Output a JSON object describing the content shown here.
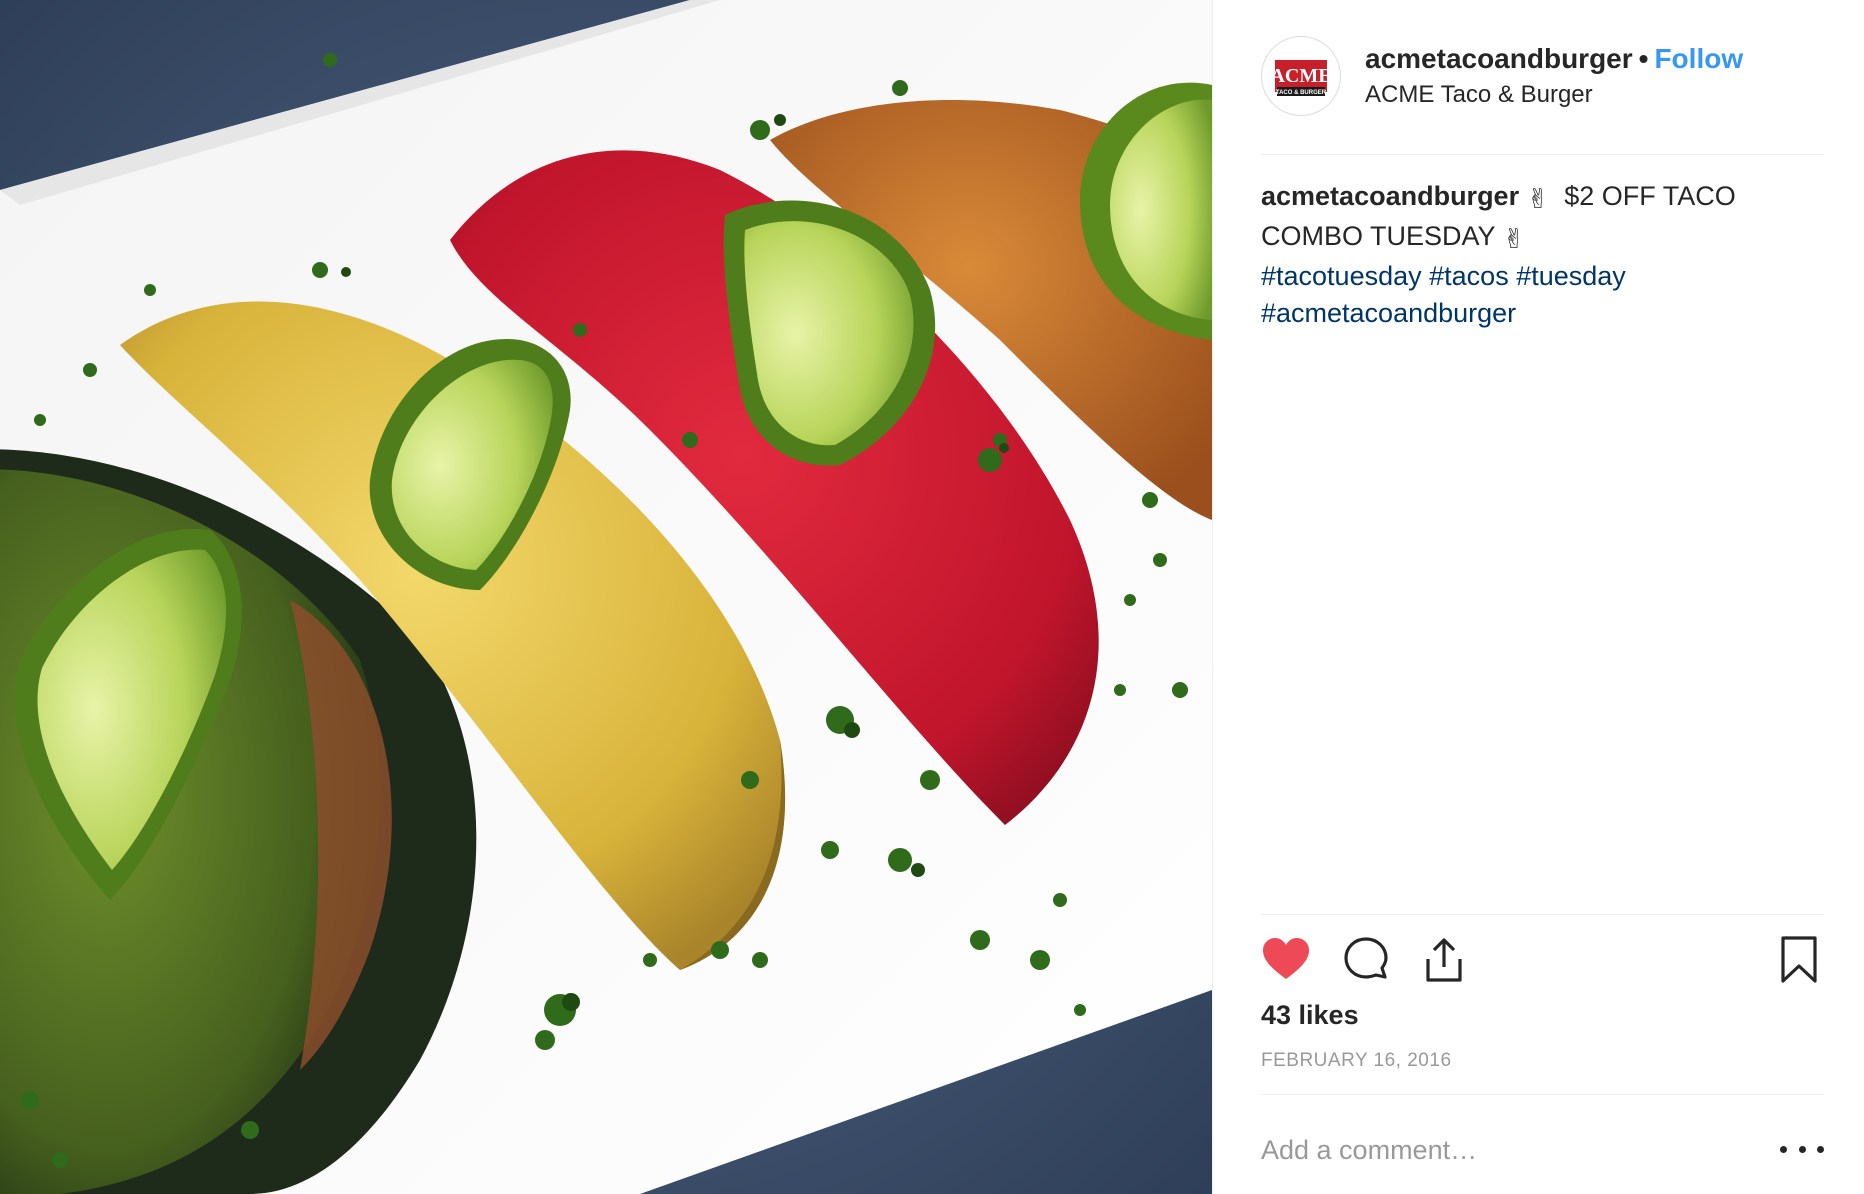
{
  "post": {
    "image": {
      "alt_icon": "taco-photo",
      "description_colors": {
        "plate": "#ffffff",
        "background": "#3b4f6b"
      }
    },
    "header": {
      "avatar_icon": "acme-logo",
      "logo_text_main": "ACME",
      "logo_text_sub": "TACO & BURGER",
      "username": "acmetacoandburger",
      "separator": "•",
      "follow_label": "Follow",
      "location": "ACME Taco & Burger"
    },
    "caption": {
      "username": "acmetacoandburger",
      "emoji_1": "✌",
      "text_line": "$2 OFF TACO COMBO TUESDAY",
      "emoji_2": "✌",
      "hashtags": [
        "#tacotuesday",
        "#tacos",
        "#tuesday",
        "#acmetacoandburger"
      ]
    },
    "actions": {
      "like_icon": "heart-filled-icon",
      "comment_icon": "comment-icon",
      "share_icon": "share-icon",
      "save_icon": "bookmark-icon"
    },
    "likes_text": "43 likes",
    "date": "FEBRUARY 16, 2016",
    "comment": {
      "placeholder": "Add a comment…",
      "more_icon": "more-options-icon"
    },
    "colors": {
      "accent_follow": "#3897f0",
      "hashtag": "#003569",
      "heart": "#ed4956",
      "muted": "#999999",
      "text": "#262626",
      "logo_red": "#c8202a"
    }
  }
}
